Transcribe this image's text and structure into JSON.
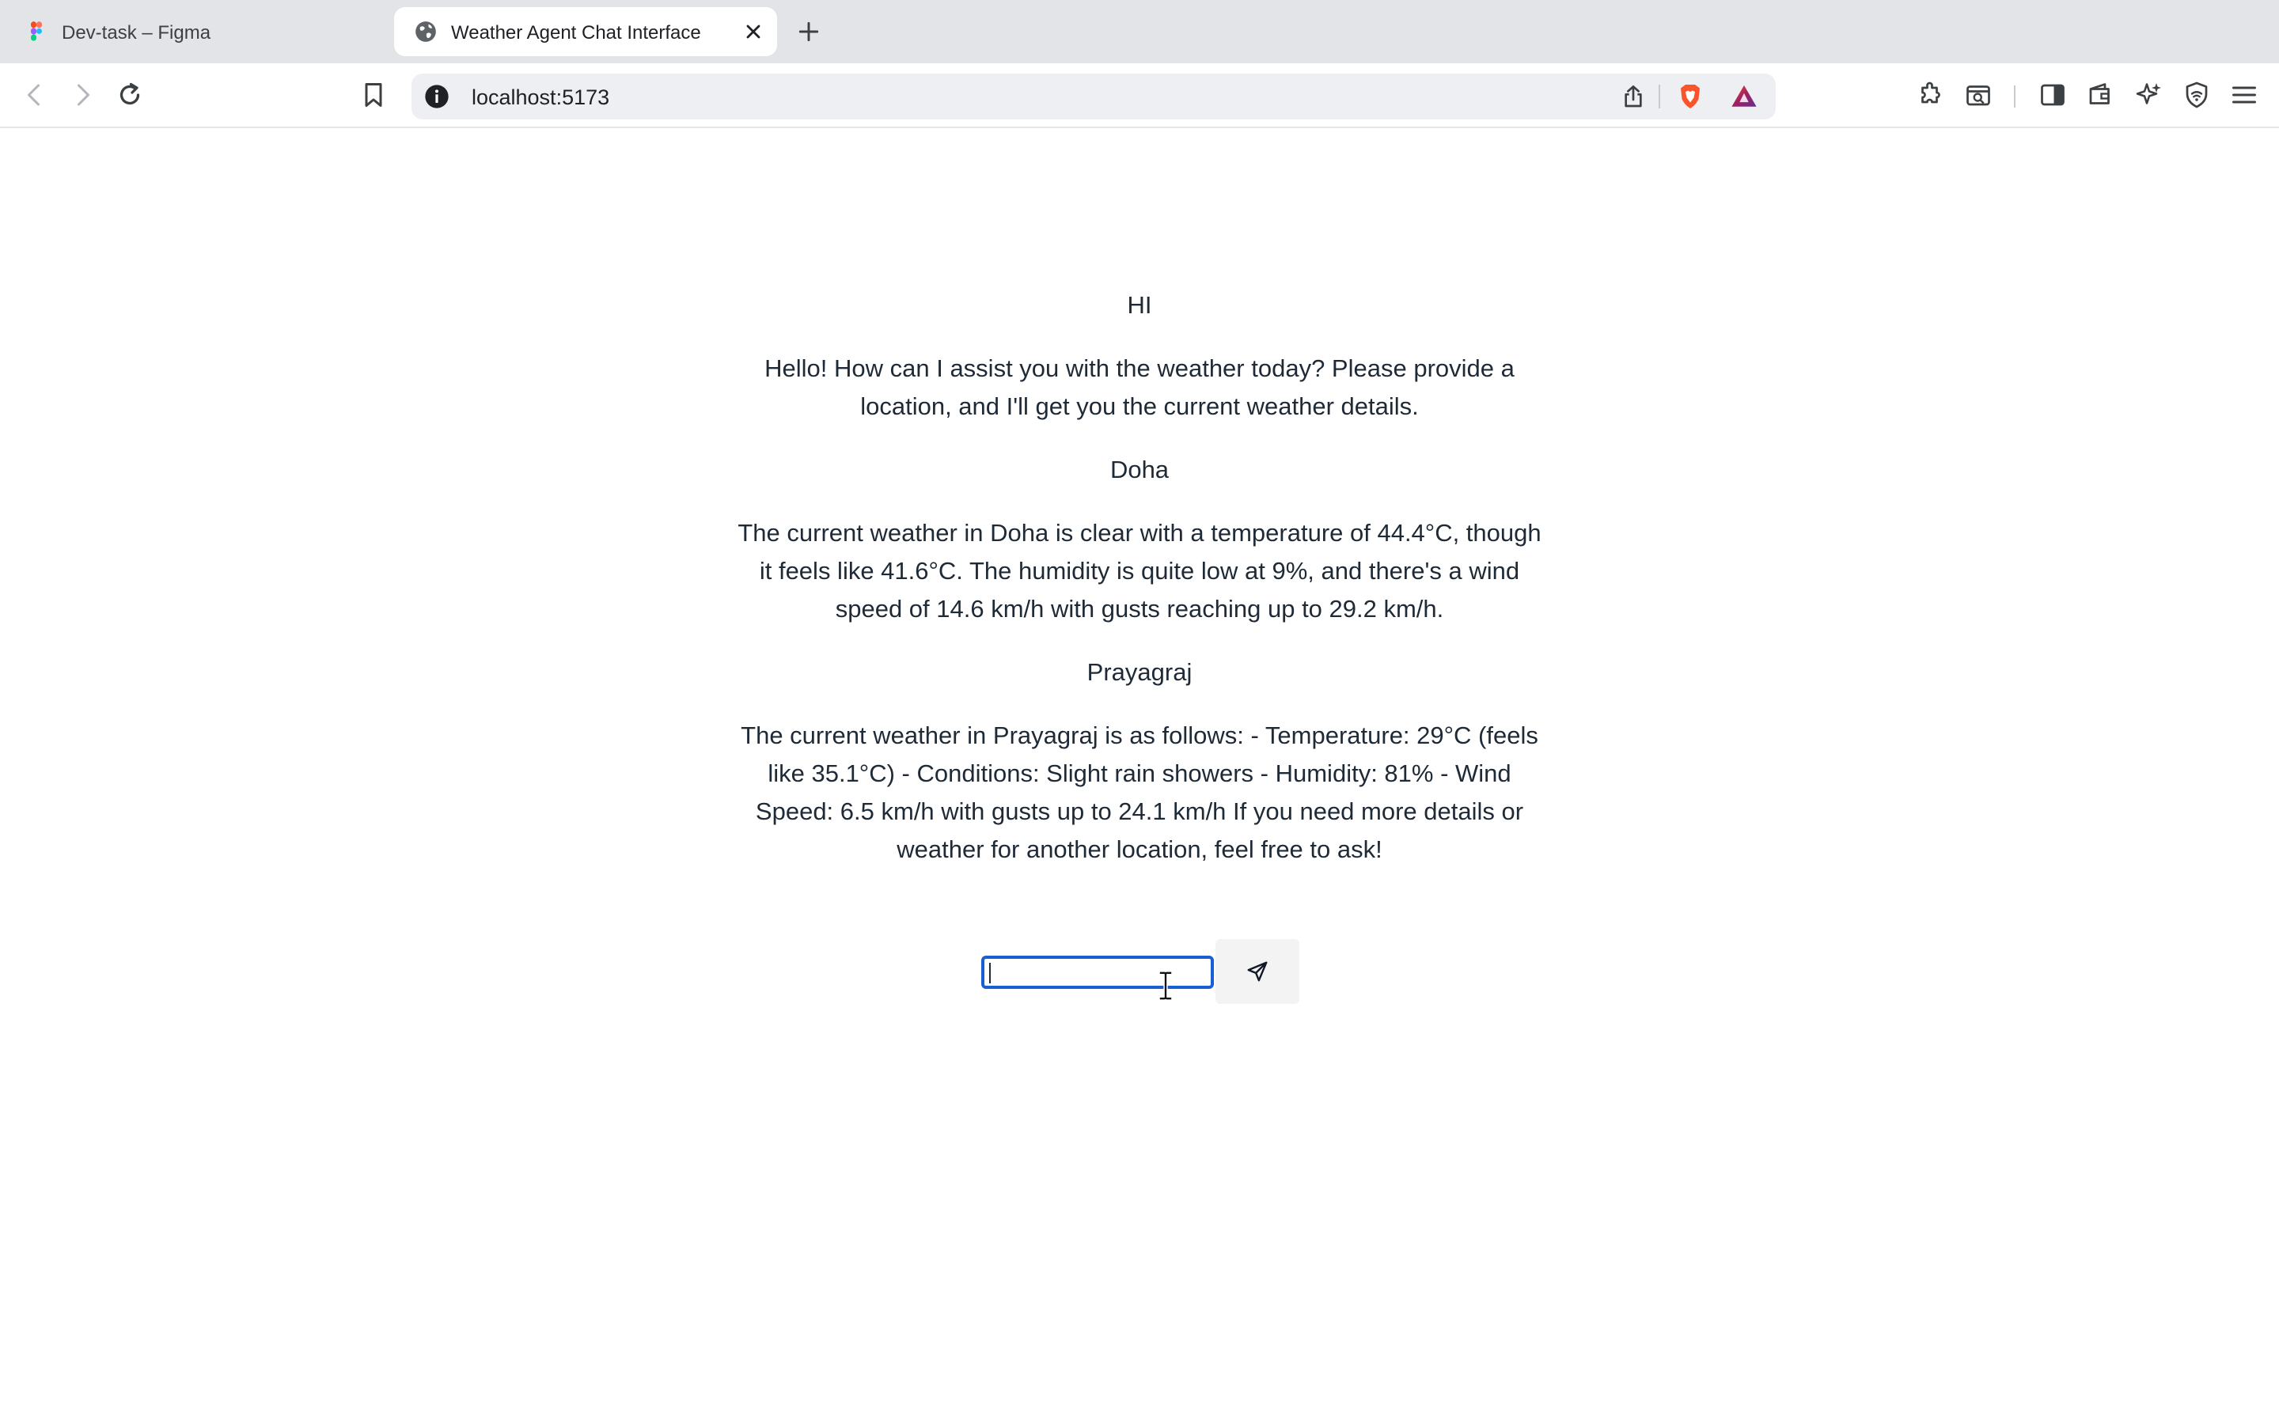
{
  "browser": {
    "tabs": [
      {
        "title": "Dev-task – Figma",
        "favicon": "figma-icon",
        "active": false
      },
      {
        "title": "Weather Agent Chat Interface",
        "favicon": "globe-icon",
        "active": true
      }
    ],
    "address_bar": {
      "url": "localhost:5173"
    },
    "toolbar_icons": [
      "back-icon",
      "forward-icon",
      "reload-icon",
      "bookmark-icon",
      "info-icon",
      "share-icon",
      "brave-shields-icon",
      "brave-rewards-icon",
      "extensions-icon",
      "screenshot-icon",
      "sidebar-icon",
      "wallet-icon",
      "leo-ai-icon",
      "vpn-icon",
      "menu-icon"
    ],
    "accent_color": "#1a5fd1"
  },
  "chat": {
    "messages": [
      {
        "role": "user",
        "text": "HI"
      },
      {
        "role": "assistant",
        "text": "Hello! How can I assist you with the weather today? Please provide a location, and I'll get you the current weather details."
      },
      {
        "role": "user",
        "text": "Doha"
      },
      {
        "role": "assistant",
        "text": "The current weather in Doha is clear with a temperature of 44.4°C, though it feels like 41.6°C. The humidity is quite low at 9%, and there's a wind speed of 14.6 km/h with gusts reaching up to 29.2 km/h."
      },
      {
        "role": "user",
        "text": "Prayagraj"
      },
      {
        "role": "assistant",
        "text": "The current weather in Prayagraj is as follows: - Temperature: 29°C (feels like 35.1°C) - Conditions: Slight rain showers - Humidity: 81% - Wind Speed: 6.5 km/h with gusts up to 24.1 km/h If you need more details or weather for another location, feel free to ask!"
      }
    ],
    "input": {
      "value": "",
      "placeholder": ""
    },
    "send_icon": "send-icon"
  }
}
